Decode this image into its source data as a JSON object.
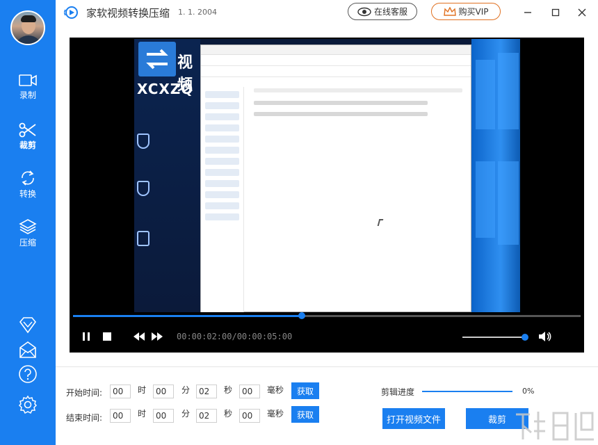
{
  "app": {
    "title": "家软视频转换压缩",
    "version": "1. 1. 2004"
  },
  "header": {
    "service_label": "在线客服",
    "vip_label": "购买VIP"
  },
  "sidebar": {
    "items": [
      {
        "label": "录制",
        "icon": "video-camera-icon"
      },
      {
        "label": "裁剪",
        "icon": "scissors-icon"
      },
      {
        "label": "转换",
        "icon": "convert-arrows-icon"
      },
      {
        "label": "压缩",
        "icon": "layers-icon"
      }
    ],
    "bottom_icons": [
      "diamond-icon",
      "mail-icon",
      "help-icon",
      "settings-icon"
    ]
  },
  "video": {
    "logo_text": "视频",
    "logo_sub": "XCXZQ",
    "progress": 0.45,
    "time_display": "00:00:02:00/00:00:05:00",
    "volume": 1.0
  },
  "trim": {
    "start_label": "开始时间:",
    "end_label": "结束时间:",
    "units": {
      "hour": "时",
      "minute": "分",
      "second": "秒",
      "ms": "毫秒"
    },
    "start": {
      "h": "00",
      "m": "00",
      "s": "02",
      "ms": "00"
    },
    "end": {
      "h": "00",
      "m": "00",
      "s": "02",
      "ms": "00"
    },
    "get_label": "获取"
  },
  "clip": {
    "progress_label": "剪辑进度",
    "progress_value": "0%",
    "open_label": "打开视频文件",
    "cut_label": "裁剪"
  },
  "colors": {
    "accent": "#1a7ff0",
    "player_bg": "#000000"
  }
}
